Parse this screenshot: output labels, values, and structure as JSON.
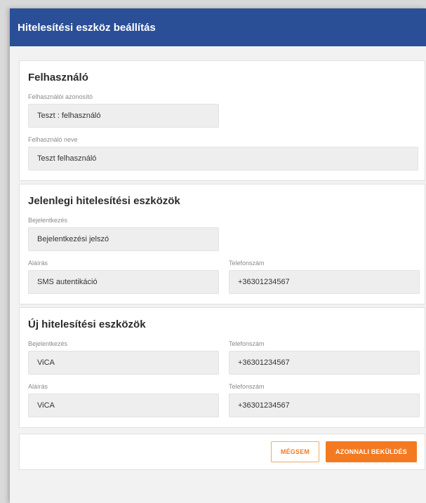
{
  "dialog": {
    "title": "Hitelesítési eszköz beállítás"
  },
  "user_section": {
    "title": "Felhasználó",
    "user_id_label": "Felhasználói azonosító",
    "user_id_value": "Teszt : felhasználó",
    "user_name_label": "Felhasználó neve",
    "user_name_value": "Teszt felhasználó"
  },
  "current_section": {
    "title": "Jelenlegi hitelesítési eszközök",
    "login_label": "Bejelentkezés",
    "login_value": "Bejelentkezési jelszó",
    "signature_label": "Aláírás",
    "signature_value": "SMS autentikáció",
    "phone_label": "Telefonszám",
    "phone_value": "+36301234567"
  },
  "new_section": {
    "title": "Új hitelesítési eszközök",
    "login_label": "Bejelentkezés",
    "login_value": "ViCA",
    "login_phone_label": "Telefonszám",
    "login_phone_value": "+36301234567",
    "signature_label": "Aláírás",
    "signature_value": "ViCA",
    "signature_phone_label": "Telefonszám",
    "signature_phone_value": "+36301234567"
  },
  "footer": {
    "cancel_label": "MÉGSEM",
    "submit_label": "AZONNALI BEKÜLDÉS"
  },
  "colors": {
    "header": "#2a4f97",
    "accent": "#f47a21"
  }
}
